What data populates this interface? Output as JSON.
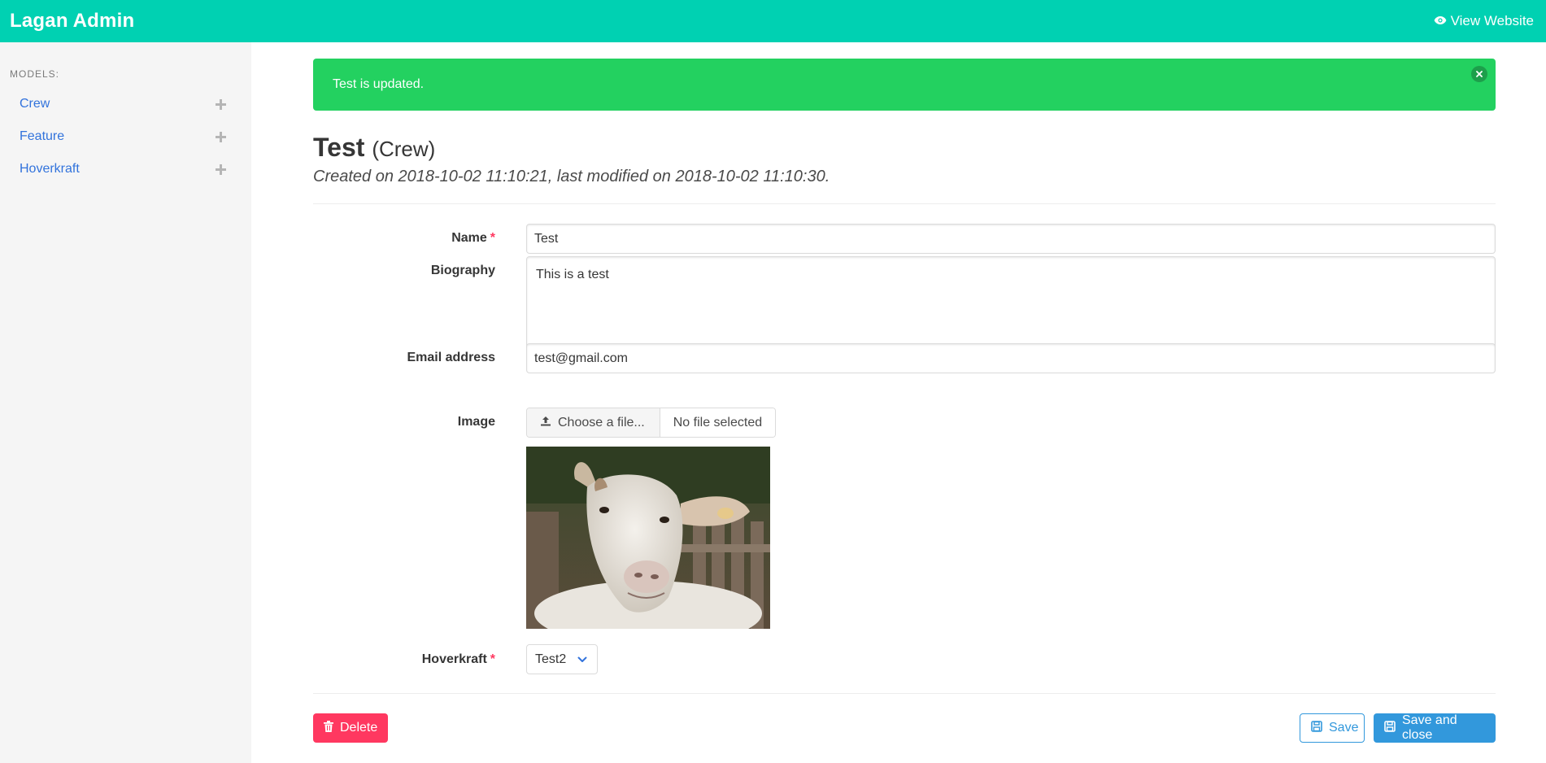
{
  "navbar": {
    "brand": "Lagan Admin",
    "view_website": "View Website"
  },
  "sidebar": {
    "label": "MODELS:",
    "items": [
      {
        "label": "Crew"
      },
      {
        "label": "Feature"
      },
      {
        "label": "Hoverkraft"
      }
    ]
  },
  "notification": {
    "message": "Test is updated."
  },
  "header": {
    "title": "Test",
    "model": "(Crew)",
    "subtitle": "Created on 2018-10-02 11:10:21, last modified on 2018-10-02 11:10:30."
  },
  "form": {
    "name": {
      "label": "Name",
      "required": "*",
      "value": "Test"
    },
    "biography": {
      "label": "Biography",
      "value": "This is a test"
    },
    "email": {
      "label": "Email address",
      "value": "test@gmail.com"
    },
    "image": {
      "label": "Image",
      "choose": "Choose a file...",
      "file_name": "No file selected"
    },
    "hoverkraft": {
      "label": "Hoverkraft",
      "required": "*",
      "selected": "Test2"
    }
  },
  "actions": {
    "delete": "Delete",
    "save": "Save",
    "save_and_close": "Save and close"
  },
  "colors": {
    "navbar": "#00d1b2",
    "success": "#23d160",
    "danger": "#ff3860",
    "info": "#3298dc",
    "link": "#3273dc"
  },
  "icons": [
    "eye-icon",
    "plus-icon",
    "close-icon",
    "upload-icon",
    "chevron-down-icon",
    "trash-icon",
    "save-icon"
  ]
}
